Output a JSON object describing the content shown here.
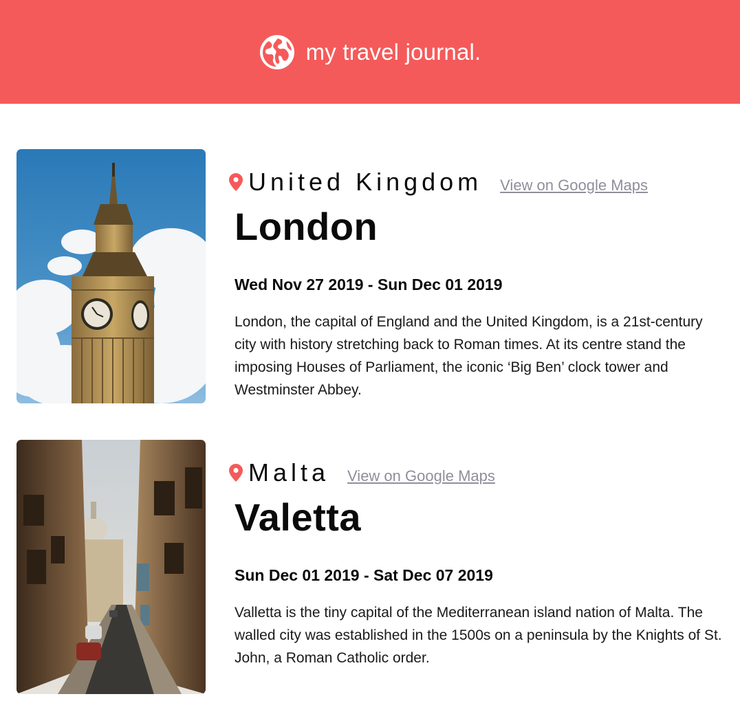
{
  "header": {
    "title": "my travel journal.",
    "background_color": "#F55A5A",
    "icon": "globe-icon"
  },
  "entries": [
    {
      "country": "United Kingdom",
      "maps_link_label": "View on Google Maps",
      "city": "London",
      "dates": "Wed Nov 27 2019 - Sun Dec 01 2019",
      "description": "London, the capital of England and the United Kingdom, is a 21st-century city with history stretching back to Roman times. At its centre stand the imposing Houses of Parliament, the iconic ‘Big Ben’ clock tower and Westminster Abbey.",
      "image": "big-ben-photo"
    },
    {
      "country": "Malta",
      "maps_link_label": "View on Google Maps",
      "city": "Valetta",
      "dates": "Sun Dec 01 2019 - Sat Dec 07 2019",
      "description": "Valletta is the tiny capital of the Mediterranean island nation of Malta. The walled city was established in the 1500s on a peninsula by the Knights of St. John, a Roman Catholic order.",
      "image": "valletta-street-photo"
    }
  ],
  "colors": {
    "accent": "#F55A5A",
    "link": "#918E9B"
  }
}
